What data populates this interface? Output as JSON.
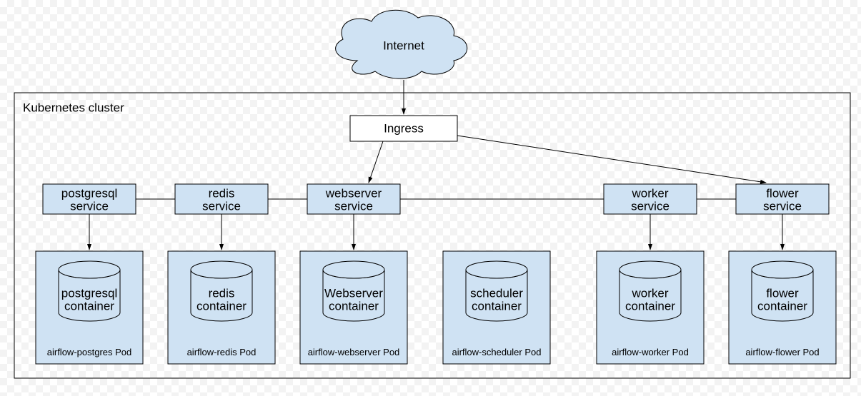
{
  "cloud": {
    "label": "Internet"
  },
  "cluster": {
    "title": "Kubernetes cluster"
  },
  "ingress": {
    "label": "Ingress"
  },
  "services": {
    "postgresql": {
      "line1": "postgresql",
      "line2": "service"
    },
    "redis": {
      "line1": "redis",
      "line2": "service"
    },
    "webserver": {
      "line1": "webserver",
      "line2": "service"
    },
    "worker": {
      "line1": "worker",
      "line2": "service"
    },
    "flower": {
      "line1": "flower",
      "line2": "service"
    }
  },
  "pods": {
    "postgres": {
      "container_line1": "postgresql",
      "container_line2": "container",
      "pod_label": "airflow-postgres Pod"
    },
    "redis": {
      "container_line1": "redis",
      "container_line2": "container",
      "pod_label": "airflow-redis Pod"
    },
    "webserver": {
      "container_line1": "Webserver",
      "container_line2": "container",
      "pod_label": "airflow-webserver Pod"
    },
    "scheduler": {
      "container_line1": "scheduler",
      "container_line2": "container",
      "pod_label": "airflow-scheduler Pod"
    },
    "worker": {
      "container_line1": "worker",
      "container_line2": "container",
      "pod_label": "airflow-worker Pod"
    },
    "flower": {
      "container_line1": "flower",
      "container_line2": "container",
      "pod_label": "airflow-flower Pod"
    }
  }
}
